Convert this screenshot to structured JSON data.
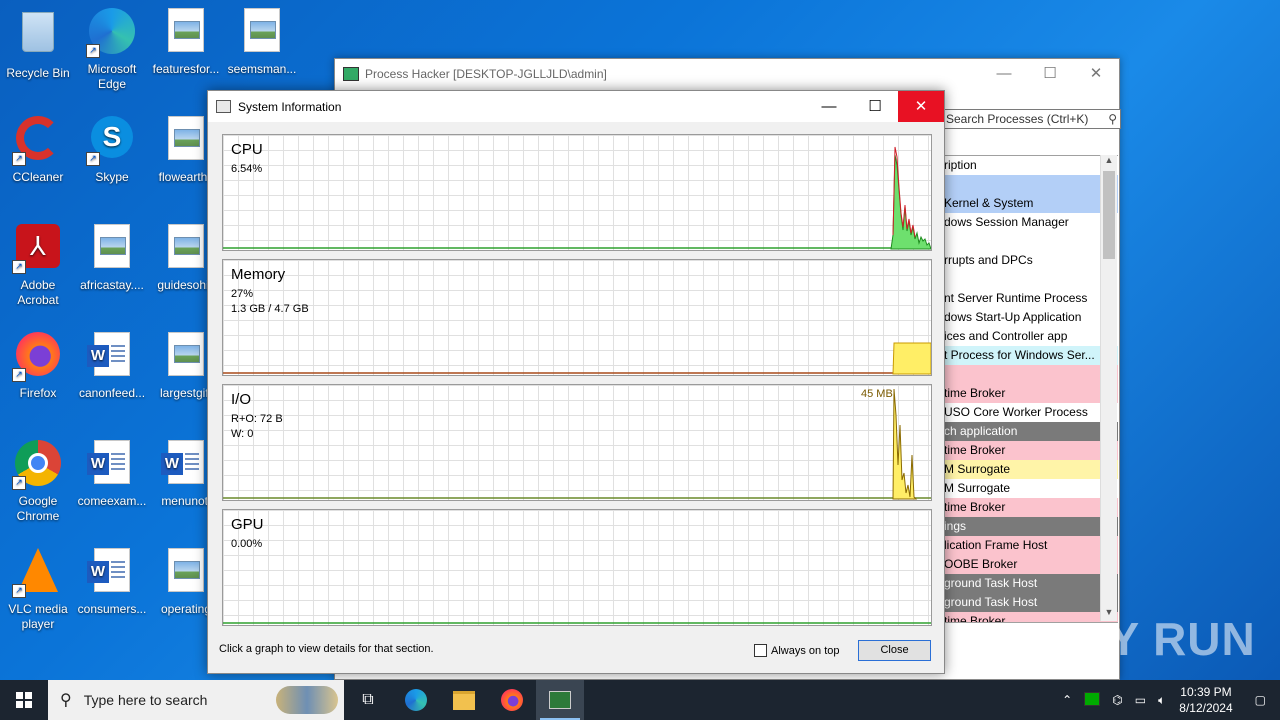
{
  "desktop": {
    "icons": [
      {
        "label": "Recycle Bin"
      },
      {
        "label": "Microsoft Edge"
      },
      {
        "label": "featuresfor..."
      },
      {
        "label": "seemsman..."
      },
      {
        "label": "CCleaner"
      },
      {
        "label": "Skype"
      },
      {
        "label": "flowearth.j"
      },
      {
        "label": "Adobe Acrobat"
      },
      {
        "label": "africastay...."
      },
      {
        "label": "guidesohic"
      },
      {
        "label": "Firefox"
      },
      {
        "label": "canonfeed..."
      },
      {
        "label": "largestgift"
      },
      {
        "label": "Google Chrome"
      },
      {
        "label": "comeexam..."
      },
      {
        "label": "menunoti"
      },
      {
        "label": "VLC media player"
      },
      {
        "label": "consumers..."
      },
      {
        "label": "operating"
      }
    ]
  },
  "process_hacker": {
    "title": "Process Hacker [DESKTOP-JGLLJLD\\admin]",
    "search_placeholder": "Search Processes (Ctrl+K)",
    "rows": [
      {
        "text": "ription",
        "bg": "#ffffff"
      },
      {
        "text": "",
        "bg": "#b3cff7"
      },
      {
        "text": "Kernel & System",
        "bg": "#b3cff7"
      },
      {
        "text": "dows Session Manager",
        "bg": "#ffffff"
      },
      {
        "text": "",
        "bg": "#ffffff"
      },
      {
        "text": "rrupts and DPCs",
        "bg": "#ffffff"
      },
      {
        "text": "",
        "bg": "#ffffff"
      },
      {
        "text": "nt Server Runtime Process",
        "bg": "#ffffff"
      },
      {
        "text": "dows Start-Up Application",
        "bg": "#ffffff"
      },
      {
        "text": "ices and Controller app",
        "bg": "#ffffff"
      },
      {
        "text": "t Process for Windows Ser...",
        "bg": "#d0f4fa"
      },
      {
        "text": "",
        "bg": "#fbc3cd"
      },
      {
        "text": "time Broker",
        "bg": "#fbc3cd"
      },
      {
        "text": "USO Core Worker Process",
        "bg": "#ffffff"
      },
      {
        "text": "ch application",
        "bg": "#7a7a7a"
      },
      {
        "text": "time Broker",
        "bg": "#fbc3cd"
      },
      {
        "text": "M Surrogate",
        "bg": "#fff4a8"
      },
      {
        "text": "M Surrogate",
        "bg": "#ffffff"
      },
      {
        "text": "time Broker",
        "bg": "#fbc3cd"
      },
      {
        "text": "ings",
        "bg": "#7a7a7a"
      },
      {
        "text": "lication Frame Host",
        "bg": "#fbc3cd"
      },
      {
        "text": "OOBE Broker",
        "bg": "#fbc3cd"
      },
      {
        "text": "ground Task Host",
        "bg": "#7a7a7a"
      },
      {
        "text": "ground Task Host",
        "bg": "#7a7a7a"
      },
      {
        "text": "time Broker",
        "bg": "#fbc3cd"
      }
    ]
  },
  "sysinfo": {
    "title": "System Information",
    "cpu": {
      "name": "CPU",
      "value": "6.54%"
    },
    "memory": {
      "name": "Memory",
      "value1": "27%",
      "value2": "1.3 GB / 4.7 GB"
    },
    "io": {
      "name": "I/O",
      "value1": "R+O: 72 B",
      "value2": "W: 0",
      "peak": "45 MB"
    },
    "gpu": {
      "name": "GPU",
      "value": "0.00%"
    },
    "footer_text": "Click a graph to view details for that section.",
    "always_on_top": "Always on top",
    "close_label": "Close"
  },
  "watermark": "ANY RUN",
  "taskbar": {
    "search_placeholder": "Type here to search",
    "time": "10:39 PM",
    "date": "8/12/2024"
  }
}
